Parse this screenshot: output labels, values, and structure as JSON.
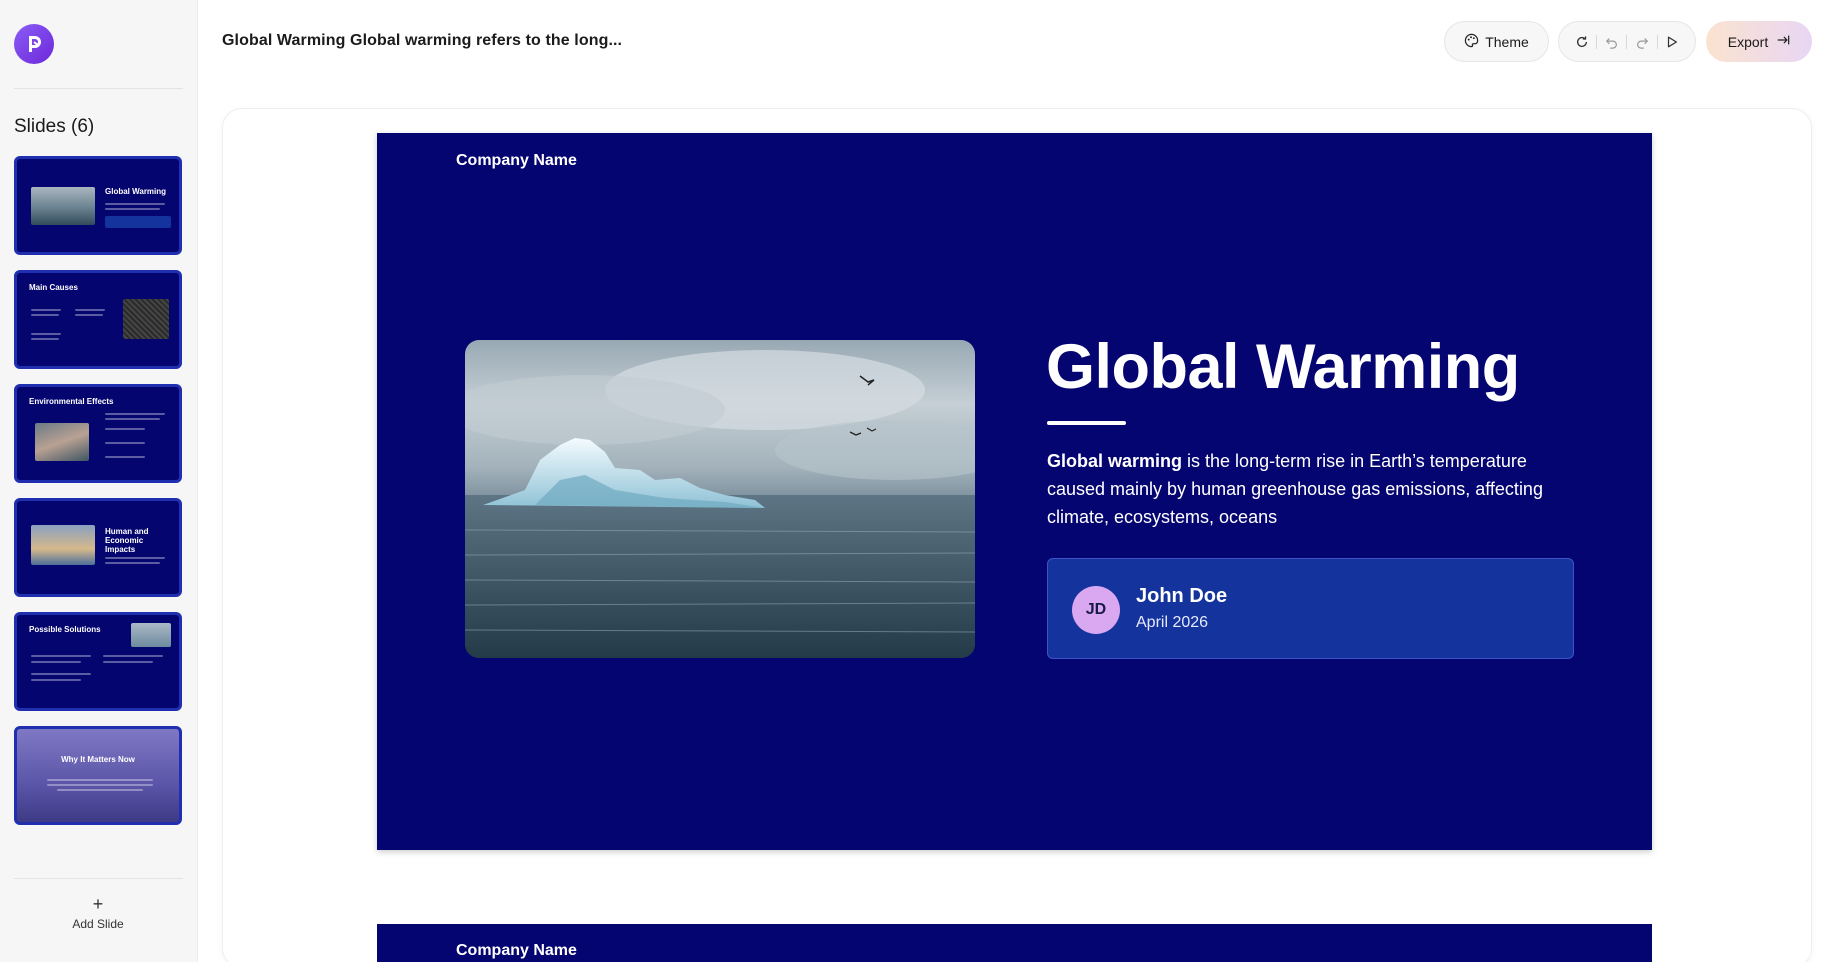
{
  "header": {
    "doc_title": "Global Warming Global warming refers to the long...",
    "theme_label": "Theme",
    "export_label": "Export"
  },
  "sidebar": {
    "slides_heading": "Slides (6)",
    "add_slide_label": "Add Slide",
    "thumbnails": [
      {
        "title": "Global Warming"
      },
      {
        "title": "Main Causes"
      },
      {
        "title": "Environmental Effects"
      },
      {
        "title": "Human and Economic Impacts"
      },
      {
        "title": "Possible Solutions"
      },
      {
        "title": "Why It Matters Now"
      }
    ]
  },
  "slide": {
    "company": "Company Name",
    "title": "Global Warming",
    "description_bold": "Global warming",
    "description_rest": " is the long-term rise in Earth’s temperature caused mainly by human greenhouse gas emissions, affecting climate, ecosystems, oceans",
    "author_initials": "JD",
    "author_name": "John Doe",
    "author_date": "April 2026"
  },
  "slide2": {
    "company": "Company Name"
  },
  "colors": {
    "slide_bg": "#050571",
    "card_bg": "#14339c",
    "avatar_bg": "#d9a8f0",
    "thumb_border": "#1f2fb0",
    "brand": "#7c3aed"
  },
  "icons": {
    "logo": "brand-logo-icon",
    "theme": "palette-icon",
    "reset": "refresh-icon",
    "undo": "undo-icon",
    "redo": "redo-icon",
    "present": "play-icon",
    "export": "export-arrow-icon",
    "add": "plus-icon"
  }
}
